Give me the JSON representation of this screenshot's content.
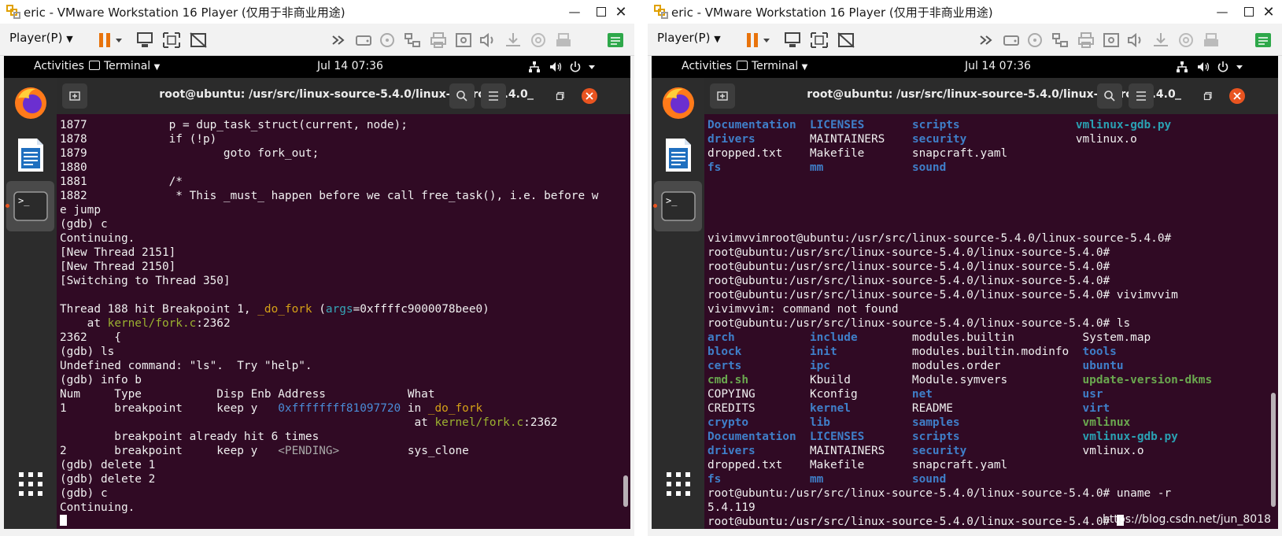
{
  "vm_windows": [
    {
      "title": "eric - VMware Workstation 16 Player (仅用于非商业用途)",
      "player_menu": "Player(P)",
      "gnome": {
        "activities": "Activities",
        "app_menu": "Terminal",
        "clock": "Jul 14  07:36"
      },
      "terminal_title": "root@ubuntu: /usr/src/linux-source-5.4.0/linux-source-5.4.0",
      "lines": [
        [
          [
            "1877            p = dup_task_struct(current, node);",
            ""
          ]
        ],
        [
          [
            "1878            if (!p)",
            ""
          ]
        ],
        [
          [
            "1879                    goto fork_out;",
            ""
          ]
        ],
        [
          [
            "1880",
            ""
          ]
        ],
        [
          [
            "1881            /*",
            ""
          ]
        ],
        [
          [
            "1882             * This _must_ happen before we call free_task(), i.e. before w",
            ""
          ]
        ],
        [
          [
            "e jump",
            ""
          ]
        ],
        [
          [
            "(gdb) c",
            ""
          ]
        ],
        [
          [
            "Continuing.",
            ""
          ]
        ],
        [
          [
            "[New Thread 2151]",
            ""
          ]
        ],
        [
          [
            "[New Thread 2150]",
            ""
          ]
        ],
        [
          [
            "[Switching to Thread 350]",
            ""
          ]
        ],
        [
          [
            "",
            ""
          ]
        ],
        [
          [
            "Thread 188 hit Breakpoint 1, ",
            ""
          ],
          [
            "_do_fork",
            "gold"
          ],
          [
            " (",
            ""
          ],
          [
            "args",
            "teal"
          ],
          [
            "=0xffffc9000078bee0)",
            ""
          ]
        ],
        [
          [
            "    at ",
            ""
          ],
          [
            "kernel/fork.c",
            "olive"
          ],
          [
            ":2362",
            ""
          ]
        ],
        [
          [
            "2362    {",
            ""
          ]
        ],
        [
          [
            "(gdb) ls",
            ""
          ]
        ],
        [
          [
            "Undefined command: \"ls\".  Try \"help\".",
            ""
          ]
        ],
        [
          [
            "(gdb) info b",
            ""
          ]
        ],
        [
          [
            "Num     Type           Disp Enb Address            What",
            ""
          ]
        ],
        [
          [
            "1       breakpoint     keep y   ",
            ""
          ],
          [
            "0xffffffff81097720",
            "addr"
          ],
          [
            " in ",
            ""
          ],
          [
            "_do_fork",
            "gold"
          ]
        ],
        [
          [
            "                                                    at ",
            ""
          ],
          [
            "kernel/fork.c",
            "olive"
          ],
          [
            ":2362",
            ""
          ]
        ],
        [
          [
            "        breakpoint already hit 6 times",
            ""
          ]
        ],
        [
          [
            "2       breakpoint     keep y   ",
            ""
          ],
          [
            "<PENDING>",
            "dim"
          ],
          [
            "          sys_clone",
            ""
          ]
        ],
        [
          [
            "(gdb) delete 1",
            ""
          ]
        ],
        [
          [
            "(gdb) delete 2",
            ""
          ]
        ],
        [
          [
            "(gdb) c",
            ""
          ]
        ],
        [
          [
            "Continuing.",
            ""
          ]
        ],
        [
          [
            "",
            "cursor"
          ]
        ]
      ]
    },
    {
      "title": "eric - VMware Workstation 16 Player (仅用于非商业用途)",
      "player_menu": "Player(P)",
      "gnome": {
        "activities": "Activities",
        "app_menu": "Terminal",
        "clock": "Jul 14  07:36"
      },
      "terminal_title": "root@ubuntu: /usr/src/linux-source-5.4.0/linux-source-5.4.0",
      "lines": [
        [
          [
            "Documentation",
            "blue"
          ],
          [
            "  ",
            ""
          ],
          [
            "LICENSES",
            "blue"
          ],
          [
            "       ",
            ""
          ],
          [
            "scripts",
            "blue"
          ],
          [
            "                 ",
            ""
          ],
          [
            "vmlinux-gdb.py",
            "cyan"
          ]
        ],
        [
          [
            "drivers",
            "blue"
          ],
          [
            "        MAINTAINERS    ",
            ""
          ],
          [
            "security",
            "blue"
          ],
          [
            "                vmlinux.o",
            ""
          ]
        ],
        [
          [
            "dropped.txt    Makefile       snapcraft.yaml",
            ""
          ]
        ],
        [
          [
            "fs",
            "blue"
          ],
          [
            "             ",
            ""
          ],
          [
            "mm",
            "blue"
          ],
          [
            "             ",
            ""
          ],
          [
            "sound",
            "blue"
          ]
        ],
        [
          [
            "",
            ""
          ]
        ],
        [
          [
            "",
            ""
          ]
        ],
        [
          [
            "",
            ""
          ]
        ],
        [
          [
            "",
            ""
          ]
        ],
        [
          [
            "vivimvvimroot@ubuntu:/usr/src/linux-source-5.4.0/linux-source-5.4.0#",
            ""
          ]
        ],
        [
          [
            "root@ubuntu:/usr/src/linux-source-5.4.0/linux-source-5.4.0#",
            ""
          ]
        ],
        [
          [
            "root@ubuntu:/usr/src/linux-source-5.4.0/linux-source-5.4.0#",
            ""
          ]
        ],
        [
          [
            "root@ubuntu:/usr/src/linux-source-5.4.0/linux-source-5.4.0#",
            ""
          ]
        ],
        [
          [
            "root@ubuntu:/usr/src/linux-source-5.4.0/linux-source-5.4.0# vivimvvim",
            ""
          ]
        ],
        [
          [
            "vivimvvim: command not found",
            ""
          ]
        ],
        [
          [
            "root@ubuntu:/usr/src/linux-source-5.4.0/linux-source-5.4.0# ls",
            ""
          ]
        ],
        [
          [
            "arch",
            "blue"
          ],
          [
            "           ",
            ""
          ],
          [
            "include",
            "blue"
          ],
          [
            "        modules.builtin          System.map",
            ""
          ]
        ],
        [
          [
            "block",
            "blue"
          ],
          [
            "          ",
            ""
          ],
          [
            "init",
            "blue"
          ],
          [
            "           modules.builtin.modinfo  ",
            ""
          ],
          [
            "tools",
            "blue"
          ]
        ],
        [
          [
            "certs",
            "blue"
          ],
          [
            "          ",
            ""
          ],
          [
            "ipc",
            "blue"
          ],
          [
            "            modules.order            ",
            ""
          ],
          [
            "ubuntu",
            "blue"
          ]
        ],
        [
          [
            "cmd.sh",
            "green"
          ],
          [
            "         Kbuild         Module.symvers           ",
            ""
          ],
          [
            "update-version-dkms",
            "green"
          ]
        ],
        [
          [
            "COPYING        Kconfig        ",
            ""
          ],
          [
            "net",
            "blue"
          ],
          [
            "                      ",
            ""
          ],
          [
            "usr",
            "blue"
          ]
        ],
        [
          [
            "CREDITS        ",
            ""
          ],
          [
            "kernel",
            "blue"
          ],
          [
            "         README                   ",
            ""
          ],
          [
            "virt",
            "blue"
          ]
        ],
        [
          [
            "crypto",
            "blue"
          ],
          [
            "         ",
            ""
          ],
          [
            "lib",
            "blue"
          ],
          [
            "            ",
            ""
          ],
          [
            "samples",
            "blue"
          ],
          [
            "                  ",
            ""
          ],
          [
            "vmlinux",
            "green"
          ]
        ],
        [
          [
            "Documentation",
            "blue"
          ],
          [
            "  ",
            ""
          ],
          [
            "LICENSES",
            "blue"
          ],
          [
            "       ",
            ""
          ],
          [
            "scripts",
            "blue"
          ],
          [
            "                  ",
            ""
          ],
          [
            "vmlinux-gdb.py",
            "cyan"
          ]
        ],
        [
          [
            "drivers",
            "blue"
          ],
          [
            "        MAINTAINERS    ",
            ""
          ],
          [
            "security",
            "blue"
          ],
          [
            "                 vmlinux.o",
            ""
          ]
        ],
        [
          [
            "dropped.txt    Makefile       snapcraft.yaml",
            ""
          ]
        ],
        [
          [
            "fs",
            "blue"
          ],
          [
            "             ",
            ""
          ],
          [
            "mm",
            "blue"
          ],
          [
            "             ",
            ""
          ],
          [
            "sound",
            "blue"
          ]
        ],
        [
          [
            "root@ubuntu:/usr/src/linux-source-5.4.0/linux-source-5.4.0# uname -r",
            ""
          ]
        ],
        [
          [
            "5.4.119",
            ""
          ]
        ],
        [
          [
            "root@ubuntu:/usr/src/linux-source-5.4.0/linux-source-5.4.0# ",
            ""
          ],
          [
            "",
            "cursor"
          ]
        ]
      ],
      "watermark": "https://blog.csdn.net/jun_8018"
    }
  ]
}
